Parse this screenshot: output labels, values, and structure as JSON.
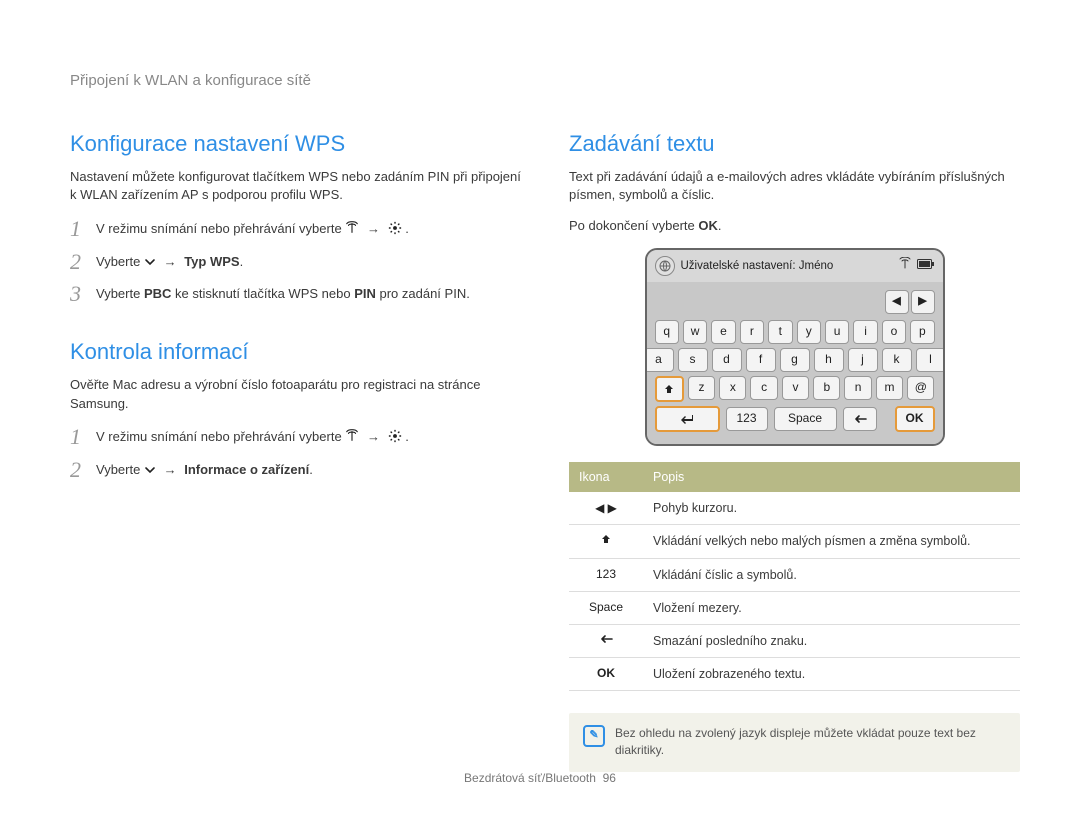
{
  "breadcrumb": "Připojení k WLAN a konfigurace sítě",
  "wps": {
    "title": "Konfigurace nastavení WPS",
    "intro": "Nastavení můžete konfigurovat tlačítkem WPS nebo zadáním PIN při připojení k WLAN zařízením AP s podporou profilu WPS.",
    "step1": "V režimu snímání nebo přehrávání vyberte",
    "step2_prefix": "Vyberte",
    "step2_suffix": "Typ WPS",
    "step3_a": "Vyberte ",
    "step3_b": "PBC",
    "step3_c": " ke stisknutí tlačítka WPS nebo ",
    "step3_d": "PIN",
    "step3_e": " pro zadání PIN."
  },
  "info": {
    "title": "Kontrola informací",
    "intro": "Ověřte Mac adresu a výrobní číslo fotoaparátu pro registraci na stránce Samsung.",
    "step1": "V režimu snímání nebo přehrávání vyberte",
    "step2_prefix": "Vyberte",
    "step2_suffix": "Informace o zařízení"
  },
  "text": {
    "title": "Zadávání textu",
    "intro": "Text při zadávání údajů a e-mailových adres vkládáte vybíráním příslušných písmen, symbolů a číslic.",
    "done_a": "Po dokončení vyberte ",
    "done_b": "OK",
    "kbd_title": "Uživatelské nastavení: Jméno",
    "rows": {
      "r1": [
        "q",
        "w",
        "e",
        "r",
        "t",
        "y",
        "u",
        "i",
        "o",
        "p"
      ],
      "r2": [
        "a",
        "s",
        "d",
        "f",
        "g",
        "h",
        "j",
        "k",
        "l"
      ],
      "r3": [
        "z",
        "x",
        "c",
        "v",
        "b",
        "n",
        "m",
        "@"
      ]
    },
    "key_123": "123",
    "key_space": "Space",
    "key_ok": "OK",
    "table": {
      "h1": "Ikona",
      "h2": "Popis",
      "rows": [
        {
          "icon_text": "◀  ▶",
          "desc": "Pohyb kurzoru."
        },
        {
          "icon_text": "↑",
          "desc": "Vkládání velkých nebo malých písmen a změna symbolů."
        },
        {
          "icon_text": "123",
          "desc": "Vkládání číslic a symbolů."
        },
        {
          "icon_text": "Space",
          "desc": "Vložení mezery."
        },
        {
          "icon_text": "←",
          "desc": "Smazání posledního znaku."
        },
        {
          "icon_text": "OK",
          "desc": "Uložení zobrazeného textu."
        }
      ]
    },
    "note": "Bez ohledu na zvolený jazyk displeje můžete vkládat pouze text bez diakritiky."
  },
  "footer": {
    "section": "Bezdrátová síť/Bluetooth",
    "page": "96"
  },
  "arrow_glyph": "→",
  "period": "."
}
